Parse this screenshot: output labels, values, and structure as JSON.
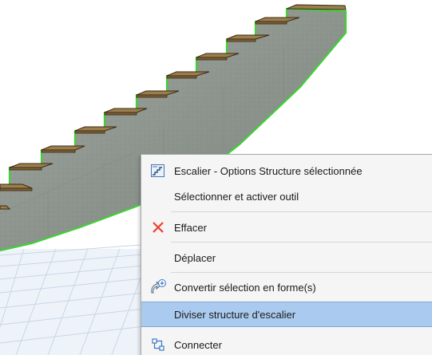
{
  "menu": {
    "items": [
      {
        "label": "Escalier - Options Structure sélectionnée",
        "icon": "stair-settings-icon"
      },
      {
        "label": "Sélectionner et activer outil"
      },
      {
        "label": "Effacer",
        "icon": "delete-x-icon"
      },
      {
        "label": "Déplacer"
      },
      {
        "label": "Convertir sélection en forme(s)",
        "icon": "convert-to-morph-icon"
      },
      {
        "label": "Diviser structure d'escalier"
      },
      {
        "label": "Connecter",
        "icon": "connect-icon"
      }
    ],
    "highlighted_index": 5
  },
  "colors": {
    "selection_outline": "#3fd135",
    "concrete": "#8e9690",
    "tread_wood": "#9c7d4d",
    "menu_highlight": "#aacbef",
    "delete_red": "#e8412f"
  }
}
